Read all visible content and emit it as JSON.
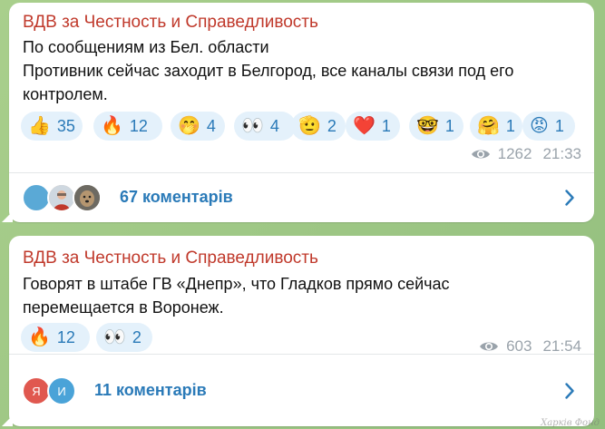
{
  "posts": [
    {
      "author": "ВДВ за Честность и Справедливость",
      "lines": [
        "По сообщениям из Бел. области",
        "Противник сейчас заходит в Белгород, все каналы связи под его",
        "контролем."
      ],
      "reactions": [
        {
          "emoji": "👍",
          "count": "35"
        },
        {
          "emoji": "🔥",
          "count": "12"
        },
        {
          "emoji": "🤭",
          "count": "4"
        },
        {
          "emoji": "👀",
          "count": "4"
        },
        {
          "emoji": "🫡",
          "count": "2"
        },
        {
          "emoji": "❤️",
          "count": "1"
        },
        {
          "emoji": "🤓",
          "count": "1"
        },
        {
          "emoji": "🤗",
          "count": "1"
        },
        {
          "emoji": "😡",
          "count": "1"
        }
      ],
      "views": "1262",
      "time": "21:33",
      "comments": "67 коментарів",
      "avatar_letters": [
        "",
        "",
        ""
      ]
    },
    {
      "author": "ВДВ за Честность и Справедливость",
      "lines": [
        "Говорят в штабе ГВ «Днепр», что Гладков прямо сейчас",
        "перемещается в Воронеж."
      ],
      "reactions": [
        {
          "emoji": "🔥",
          "count": "12"
        },
        {
          "emoji": "👀",
          "count": "2"
        }
      ],
      "views": "603",
      "time": "21:54",
      "comments": "11 коментарів",
      "avatar_letters": [
        "Я",
        "И"
      ]
    }
  ],
  "watermark": "Харків Фонд",
  "colors": {
    "author": "#c0392b",
    "accent": "#2a7ab8",
    "reaction_bg": "#e4f1fb",
    "meta": "#9aa3ab",
    "background": "#9ec58a"
  }
}
